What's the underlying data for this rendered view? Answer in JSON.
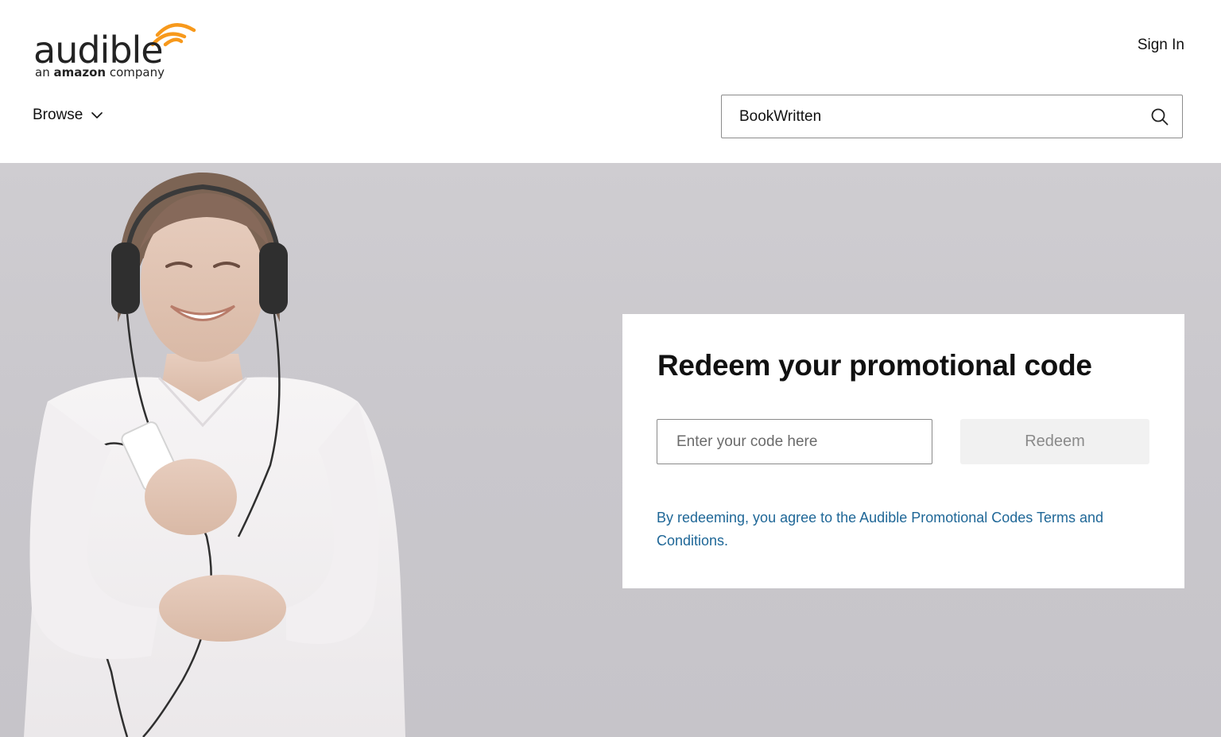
{
  "header": {
    "logo": {
      "wordmark": "audible",
      "tagline_prefix": "an",
      "tagline_brand": "amazon",
      "tagline_suffix": "company",
      "accent_color": "#f7991c"
    },
    "sign_in_label": "Sign In",
    "browse_label": "Browse",
    "search": {
      "value": "BookWritten",
      "icon": "search-icon"
    }
  },
  "redeem_card": {
    "title": "Redeem your promotional code",
    "code_placeholder": "Enter your code here",
    "redeem_button_label": "Redeem",
    "terms_text": "By redeeming, you agree to the Audible Promotional Codes Terms and Conditions.",
    "terms_color": "#1f6797"
  },
  "hero": {
    "background_color": "#cbc9cd"
  }
}
